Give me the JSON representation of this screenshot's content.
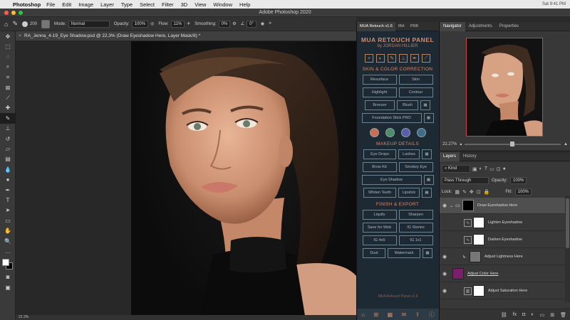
{
  "menubar": {
    "app": "Photoshop",
    "items": [
      "File",
      "Edit",
      "Image",
      "Layer",
      "Type",
      "Select",
      "Filter",
      "3D",
      "View",
      "Window",
      "Help"
    ],
    "clock": "Sat 9:41 PM"
  },
  "window": {
    "title": "Adobe Photoshop 2020"
  },
  "options": {
    "brush_size": "200",
    "mode_label": "Mode:",
    "mode_value": "Normal",
    "opacity_label": "Opacity:",
    "opacity_value": "100%",
    "flow_label": "Flow:",
    "flow_value": "11%",
    "smoothing_label": "Smoothing:",
    "smoothing_value": "0%",
    "angle_value": "0°"
  },
  "document": {
    "tab_title": "RA_Jenna_4-19_Eye Shadow.psd @ 22.3% (Draw Eyeshadow Here, Layer Mask/8) *",
    "status": "22.3%"
  },
  "mua_panel": {
    "tabs": [
      "MUA Retouch v1.6",
      "IBA",
      "PRB"
    ],
    "title": "MUA RETOUCH PANEL",
    "subtitle": "by JORDAN HILLIER",
    "section_skin": "SKIN & COLOR CORRECTION",
    "skin_buttons": [
      "Resurface",
      "Skin",
      "Highlight",
      "Contour",
      "Bronzer",
      "Blush"
    ],
    "foundation": "Foundation Stick PRO",
    "section_makeup": "MAKEUP DETAILS",
    "makeup_buttons": [
      "Eye Drops",
      "Lashes",
      "Brow Kit",
      "Smokey Eye"
    ],
    "eye_shadow": "Eye Shadow",
    "makeup_row_last": [
      "Whiten Teeth",
      "Lipstick"
    ],
    "section_finish": "FINISH & EXPORT",
    "finish_buttons": [
      "Liquify",
      "Sharpen",
      "Save for Web",
      "IG Stories",
      "IG 4x5",
      "IG 1x1",
      "Dust",
      "Watermark"
    ],
    "footer": "MUA Retouch Panel v1.6",
    "circle_colors": [
      "#c96f55",
      "#4f8c6a",
      "#5a5ea8",
      "#3d6d87"
    ]
  },
  "navigator": {
    "tabs": [
      "Navigator",
      "Adjustments",
      "Properties"
    ],
    "zoom": "22.27%"
  },
  "layers": {
    "tabs": [
      "Layers",
      "History"
    ],
    "filter_kind": "Kind",
    "blend_mode": "Pass Through",
    "opacity_label": "Opacity:",
    "opacity_value": "100%",
    "lock_label": "Lock:",
    "fill_label": "Fill:",
    "fill_value": "100%",
    "items": [
      {
        "name": "Draw Eyeshadow Here",
        "selected": true
      },
      {
        "name": "Lighten Eyeshadow",
        "selected": false
      },
      {
        "name": "Darken Eyeshadow",
        "selected": false
      },
      {
        "name": "Adjust Lightness Here",
        "selected": false
      },
      {
        "name": "Adjust Color Here",
        "selected": false
      },
      {
        "name": "Adjust Saturation Here",
        "selected": false
      }
    ]
  },
  "colors": {
    "accent_panel": "#d8896c",
    "selection_red": "#c8473f",
    "color_fill_layer": "#7a1f6b"
  }
}
